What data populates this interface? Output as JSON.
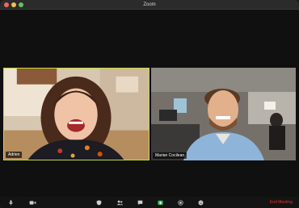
{
  "window": {
    "title": "Zoom"
  },
  "participants": [
    {
      "name": "Adrien"
    },
    {
      "name": "Marian Cocilean"
    }
  ],
  "toolbar": {
    "end_label": "End Meeting",
    "icons": [
      "microphone-icon",
      "video-camera-icon",
      "security-icon",
      "participants-icon",
      "chat-icon",
      "share-screen-icon",
      "record-icon",
      "reactions-icon"
    ]
  },
  "colors": {
    "active_speaker": "#c8d93a",
    "end_meeting": "#e0332e",
    "share_screen": "#2db84d"
  }
}
